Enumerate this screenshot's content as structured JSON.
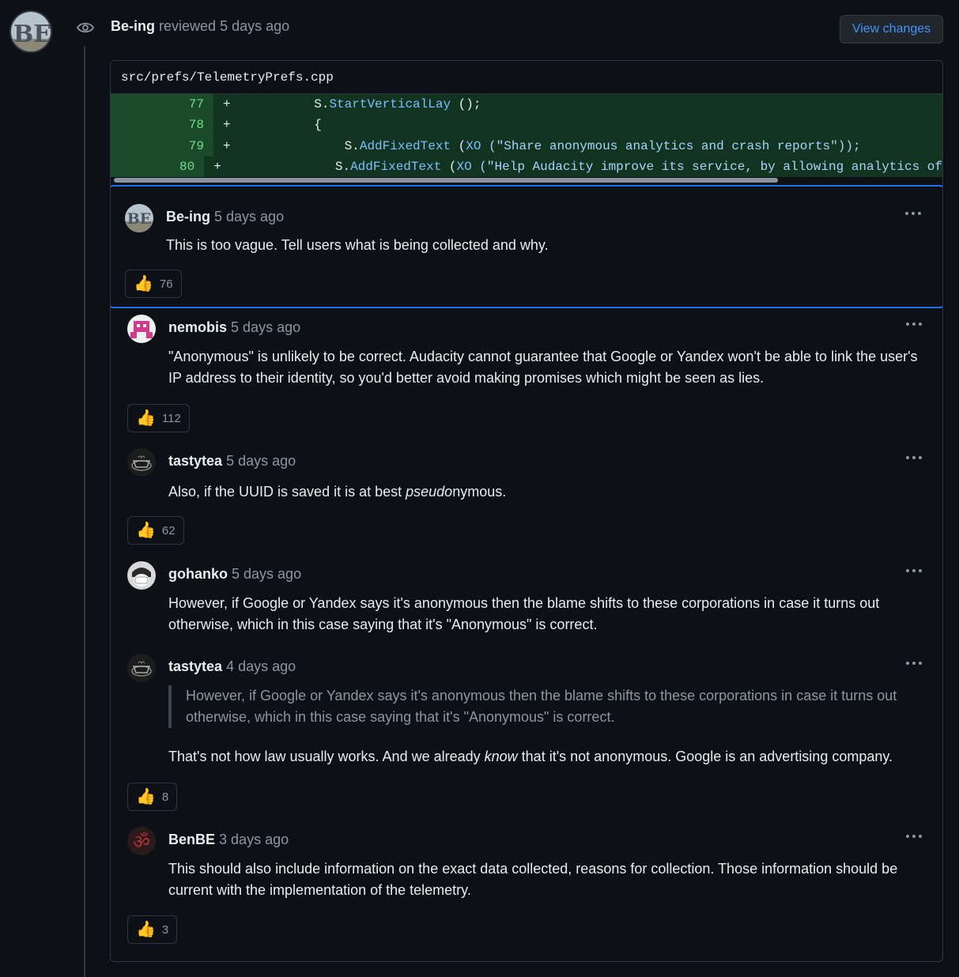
{
  "review": {
    "author": "Be-ing",
    "action": "reviewed",
    "time": "5 days ago",
    "view_changes_label": "View changes"
  },
  "file": {
    "path": "src/prefs/TelemetryPrefs.cpp",
    "lines": [
      {
        "num": "77",
        "sign": "+",
        "indent": "           ",
        "pre": "S.",
        "fn": "StartVerticalLay",
        "post": " ();"
      },
      {
        "num": "78",
        "sign": "+",
        "indent": "           ",
        "pre": "{",
        "fn": "",
        "post": ""
      },
      {
        "num": "79",
        "sign": "+",
        "indent": "               ",
        "pre": "S.",
        "fn": "AddFixedText",
        "post": " (",
        "kw": "XO",
        "str": " (\"Share anonymous analytics and crash reports\"));"
      },
      {
        "num": "80",
        "sign": "+",
        "indent": "               ",
        "pre": "S.",
        "fn": "AddFixedText",
        "post": " (",
        "kw": "XO",
        "str": " (\"Help Audacity improve its service, by allowing analytics of"
      }
    ]
  },
  "comments": [
    {
      "author": "Be-ing",
      "time": "5 days ago",
      "body": "This is too vague. Tell users what is being collected and why.",
      "reaction_emoji": "👍",
      "reaction_count": "76"
    },
    {
      "author": "nemobis",
      "time": "5 days ago",
      "body": "\"Anonymous\" is unlikely to be correct. Audacity cannot guarantee that Google or Yandex won't be able to link the user's IP address to their identity, so you'd better avoid making promises which might be seen as lies.",
      "reaction_emoji": "👍",
      "reaction_count": "112"
    },
    {
      "author": "tastytea",
      "time": "5 days ago",
      "body_pre": "Also, if the UUID is saved it is at best ",
      "body_em": "pseudo",
      "body_post": "nymous.",
      "reaction_emoji": "👍",
      "reaction_count": "62"
    },
    {
      "author": "gohanko",
      "time": "5 days ago",
      "body": "However, if Google or Yandex says it's anonymous then the blame shifts to these corporations in case it turns out otherwise, which in this case saying that it's \"Anonymous\" is correct."
    },
    {
      "author": "tastytea",
      "time": "4 days ago",
      "quote": "However, if Google or Yandex says it's anonymous then the blame shifts to these corporations in case it turns out otherwise, which in this case saying that it's \"Anonymous\" is correct.",
      "body_pre": "That's not how law usually works. And we already ",
      "body_em": "know",
      "body_post": " that it's not anonymous. Google is an advertising company.",
      "reaction_emoji": "👍",
      "reaction_count": "8"
    },
    {
      "author": "BenBE",
      "time": "3 days ago",
      "body": "This should also include information on the exact data collected, reasons for collection. Those information should be current with the implementation of the telemetry.",
      "reaction_emoji": "👍",
      "reaction_count": "3"
    }
  ],
  "colors": {
    "background": "#0d1117",
    "accent": "#4493f8",
    "highlight_border": "#1f6feb",
    "diff_add_bg": "#12331f",
    "diff_add_num_bg": "#1a4a29"
  }
}
